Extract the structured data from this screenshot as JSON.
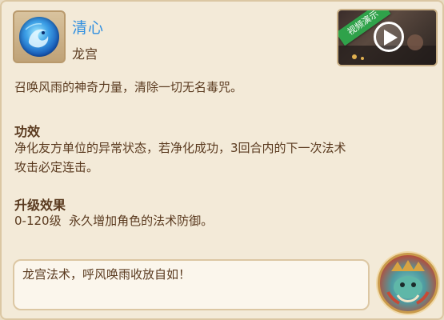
{
  "skill": {
    "name": "清心",
    "school": "龙宫",
    "icon": "water-dragon-orb-icon"
  },
  "video": {
    "label": "视频演示",
    "icon": "play-icon",
    "accent": "#2fa24a"
  },
  "description": "召唤风雨的神奇力量，清除一切无名毒咒。",
  "effect": {
    "heading": "功效",
    "lines": [
      "净化友方单位的异常状态，若净化成功，3回合内的下一次法术",
      "攻击必定连击。"
    ]
  },
  "upgrade": {
    "heading": "升级效果",
    "text": "0-120级  永久增加角色的法术防御。"
  },
  "quote": {
    "text": "龙宫法术，呼风唤雨收放自如！",
    "portrait_icon": "dragon-king-portrait-icon"
  },
  "colors": {
    "skill_name": "#2f8fe0",
    "text": "#5a3a1f",
    "panel": "#f3ead8"
  }
}
